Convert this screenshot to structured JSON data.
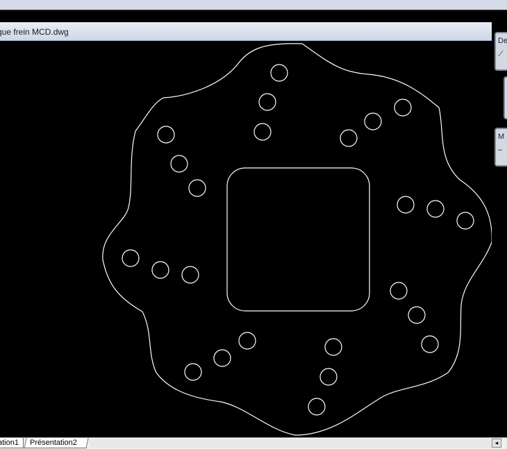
{
  "document": {
    "title": "que frein MCD.dwg"
  },
  "palettes": {
    "top_label": "De",
    "bottom_label": "M",
    "top_icon": "pencil-icon",
    "bottom_icon": "line-icon"
  },
  "layout_tabs": [
    {
      "label": "ation1"
    },
    {
      "label": "Présentation2"
    }
  ],
  "scrollbar": {
    "left_arrow": "◂"
  },
  "colors": {
    "canvas_background": "#000000",
    "drawing_stroke": "#ffffff"
  }
}
